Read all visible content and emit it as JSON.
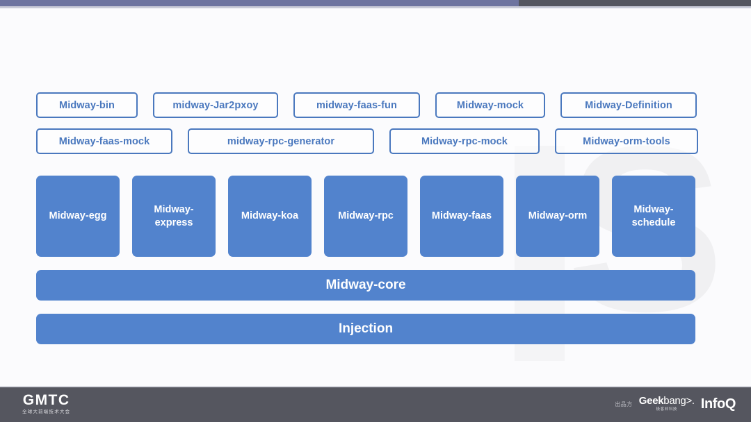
{
  "slide": {
    "background_color": "#fbfbfd",
    "watermark_text": "S"
  },
  "progress": {
    "fill_color": "#6e74a0",
    "track_color": "#545660",
    "percent": 69
  },
  "diagram": {
    "accent_outline_color": "#4a78be",
    "accent_fill_color": "#5283cd",
    "tools_row_1": [
      {
        "label": "Midway-bin"
      },
      {
        "label": "midway-Jar2pxoy"
      },
      {
        "label": "midway-faas-fun"
      },
      {
        "label": "Midway-mock"
      },
      {
        "label": "Midway-Definition"
      }
    ],
    "tools_row_2": [
      {
        "label": "Midway-faas-mock"
      },
      {
        "label": "midway-rpc-generator"
      },
      {
        "label": "Midway-rpc-mock"
      },
      {
        "label": "Midway-orm-tools"
      }
    ],
    "modules": [
      {
        "line1": "Midway-egg",
        "line2": ""
      },
      {
        "line1": "Midway-",
        "line2": "express"
      },
      {
        "line1": "Midway-koa",
        "line2": ""
      },
      {
        "line1": "Midway-rpc",
        "line2": ""
      },
      {
        "line1": "Midway-faas",
        "line2": ""
      },
      {
        "line1": "Midway-orm",
        "line2": ""
      },
      {
        "line1": "Midway-",
        "line2": "schedule"
      }
    ],
    "core_bar": "Midway-core",
    "injection_bar": "Injection"
  },
  "footer": {
    "gmtc_wordmark": "GMTC",
    "gmtc_tagline": "全球大前端技术大会",
    "sponsor_label": "出品方",
    "geekbang_bold": "Geek",
    "geekbang_thin": "bang>.",
    "geekbang_tagline": "极客邦科技",
    "infoq_wordmark": "InfoQ"
  }
}
